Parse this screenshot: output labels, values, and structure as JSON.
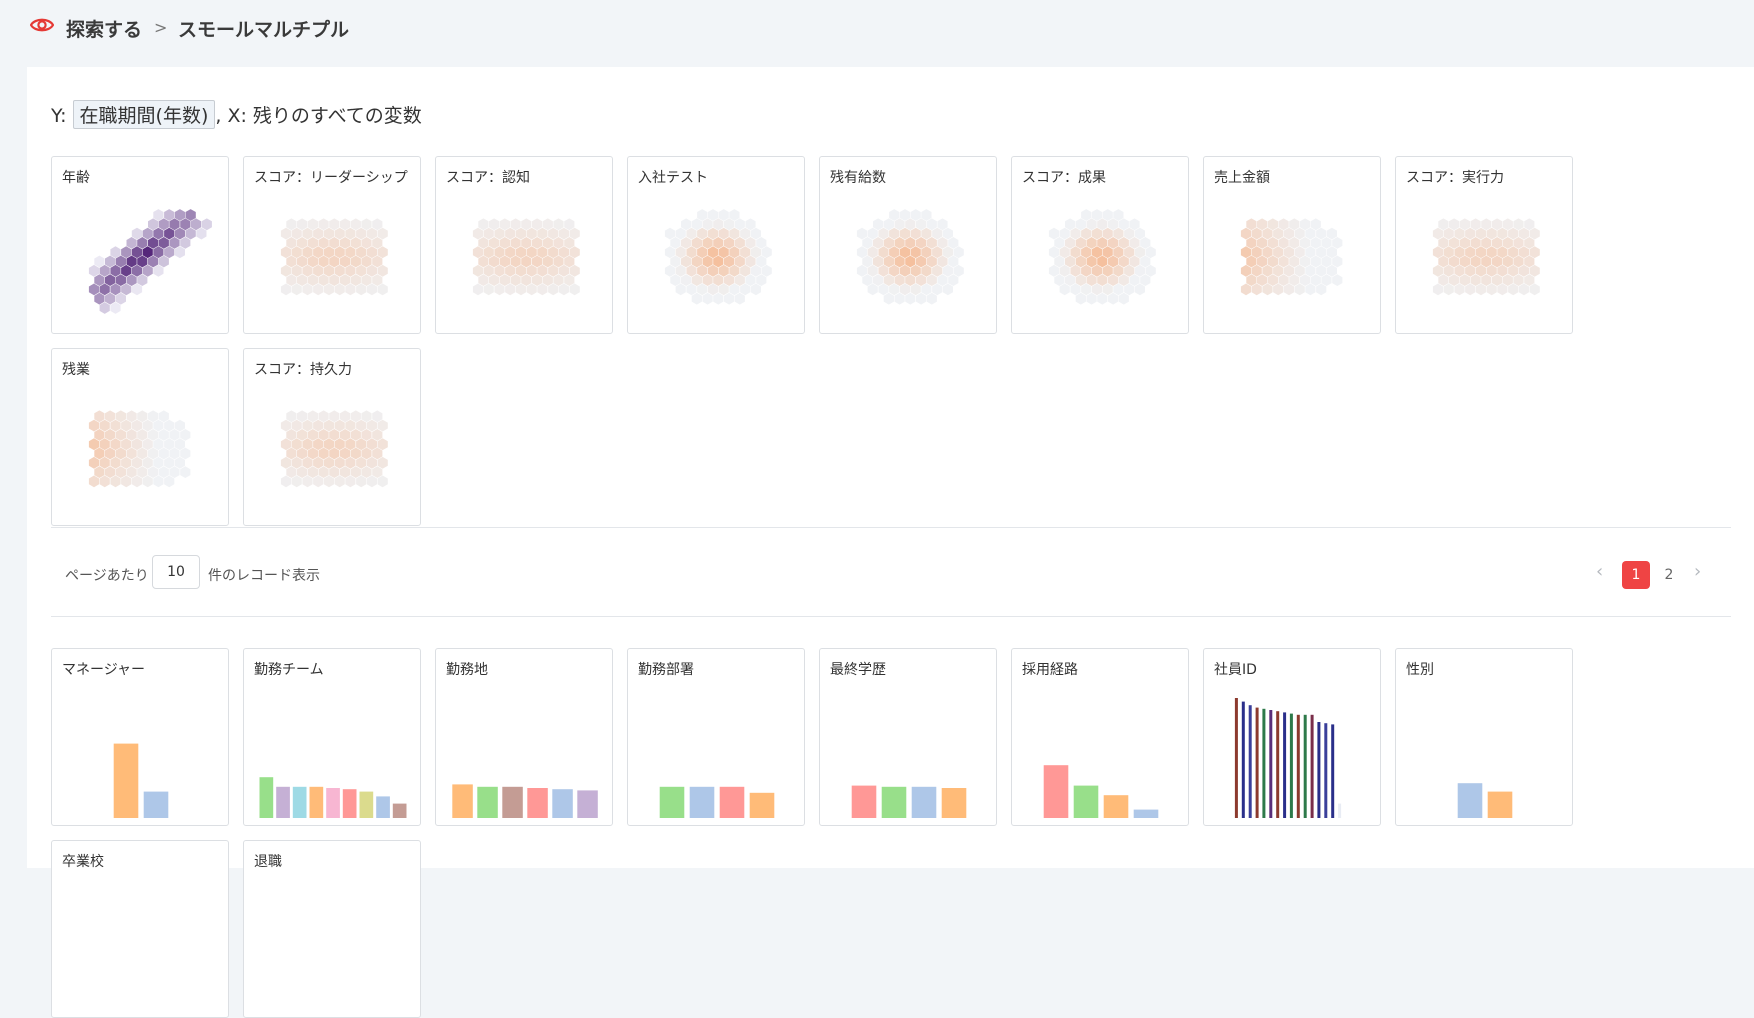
{
  "breadcrumb": {
    "root": "探索する",
    "separator": ">",
    "current": "スモールマルチプル"
  },
  "axis": {
    "y_prefix": "Y: ",
    "y_value": "在職期間(年数)",
    "x_text": ", X: 残りのすべての変数"
  },
  "numeric_cards": [
    {
      "title": "年齢",
      "pattern": "diagonal"
    },
    {
      "title": "スコア：リーダーシップ",
      "pattern": "rect"
    },
    {
      "title": "スコア：認知",
      "pattern": "rect"
    },
    {
      "title": "入社テスト",
      "pattern": "blob"
    },
    {
      "title": "残有給数",
      "pattern": "blob"
    },
    {
      "title": "スコア：成果",
      "pattern": "blob"
    },
    {
      "title": "売上金額",
      "pattern": "left"
    },
    {
      "title": "スコア：実行力",
      "pattern": "rect"
    },
    {
      "title": "残業",
      "pattern": "left"
    },
    {
      "title": "スコア：持久力",
      "pattern": "rect"
    }
  ],
  "pagination": {
    "per_page_prefix": "ページあたり",
    "per_page_value": "10",
    "per_page_suffix": "件のレコード表示",
    "prev_icon": "chevron-left-icon",
    "next_icon": "chevron-right-icon",
    "pages": [
      "1",
      "2"
    ],
    "active_page": "1"
  },
  "category_cards": [
    {
      "title": "マネージャー",
      "bars": [
        {
          "h": 0.62,
          "color": "#ffbb78"
        },
        {
          "h": 0.22,
          "color": "#aec7e8"
        }
      ]
    },
    {
      "title": "勤務チーム",
      "bars": [
        {
          "h": 0.34,
          "color": "#98df8a"
        },
        {
          "h": 0.26,
          "color": "#c5b0d5"
        },
        {
          "h": 0.26,
          "color": "#9edae5"
        },
        {
          "h": 0.26,
          "color": "#ffbb78"
        },
        {
          "h": 0.25,
          "color": "#f7b6d2"
        },
        {
          "h": 0.24,
          "color": "#ff9896"
        },
        {
          "h": 0.22,
          "color": "#dbdb8d"
        },
        {
          "h": 0.18,
          "color": "#aec7e8"
        },
        {
          "h": 0.12,
          "color": "#c49c94"
        }
      ]
    },
    {
      "title": "勤務地",
      "bars": [
        {
          "h": 0.28,
          "color": "#ffbb78"
        },
        {
          "h": 0.26,
          "color": "#98df8a"
        },
        {
          "h": 0.26,
          "color": "#c49c94"
        },
        {
          "h": 0.25,
          "color": "#ff9896"
        },
        {
          "h": 0.24,
          "color": "#aec7e8"
        },
        {
          "h": 0.23,
          "color": "#c5b0d5"
        }
      ]
    },
    {
      "title": "勤務部署",
      "bars": [
        {
          "h": 0.26,
          "color": "#98df8a"
        },
        {
          "h": 0.26,
          "color": "#aec7e8"
        },
        {
          "h": 0.26,
          "color": "#ff9896"
        },
        {
          "h": 0.21,
          "color": "#ffbb78"
        }
      ]
    },
    {
      "title": "最終学歴",
      "bars": [
        {
          "h": 0.27,
          "color": "#ff9896"
        },
        {
          "h": 0.26,
          "color": "#98df8a"
        },
        {
          "h": 0.26,
          "color": "#aec7e8"
        },
        {
          "h": 0.25,
          "color": "#ffbb78"
        }
      ]
    },
    {
      "title": "採用経路",
      "bars": [
        {
          "h": 0.44,
          "color": "#ff9896"
        },
        {
          "h": 0.27,
          "color": "#98df8a"
        },
        {
          "h": 0.19,
          "color": "#ffbb78"
        },
        {
          "h": 0.07,
          "color": "#aec7e8"
        }
      ]
    },
    {
      "title": "社員ID",
      "style": "thin",
      "bars": [
        {
          "h": 1.0,
          "color": "#8c3a2e"
        },
        {
          "h": 0.97,
          "color": "#2a2f8a"
        },
        {
          "h": 0.94,
          "color": "#3a3f9a"
        },
        {
          "h": 0.92,
          "color": "#8c3a2e"
        },
        {
          "h": 0.91,
          "color": "#2e7a4a"
        },
        {
          "h": 0.9,
          "color": "#5a2e7a"
        },
        {
          "h": 0.89,
          "color": "#8c3a2e"
        },
        {
          "h": 0.88,
          "color": "#2a2f8a"
        },
        {
          "h": 0.87,
          "color": "#2e7a4a"
        },
        {
          "h": 0.86,
          "color": "#8c3a2e"
        },
        {
          "h": 0.86,
          "color": "#2e7a4a"
        },
        {
          "h": 0.86,
          "color": "#7a2e4a"
        },
        {
          "h": 0.8,
          "color": "#2a2f8a"
        },
        {
          "h": 0.79,
          "color": "#3a3f9a"
        },
        {
          "h": 0.78,
          "color": "#2a2f8a"
        },
        {
          "h": 0.12,
          "color": "#e8ecf4"
        }
      ]
    },
    {
      "title": "性別",
      "bars": [
        {
          "h": 0.29,
          "color": "#aec7e8"
        },
        {
          "h": 0.22,
          "color": "#ffbb78"
        }
      ]
    },
    {
      "title": "卒業校",
      "bars": []
    },
    {
      "title": "退職",
      "bars": []
    }
  ]
}
